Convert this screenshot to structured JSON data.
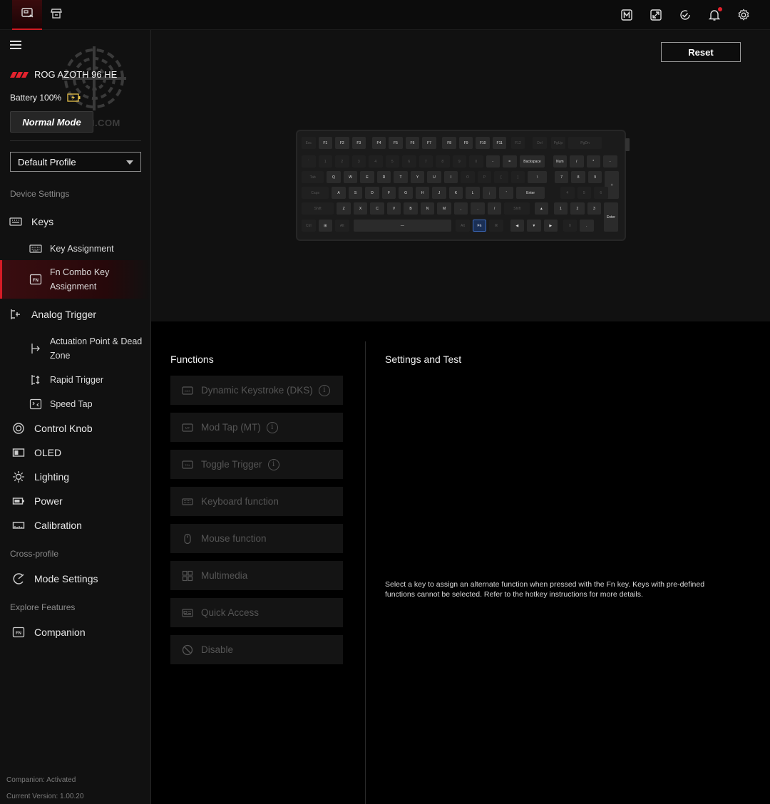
{
  "topbar": {
    "tabs": [
      {
        "icon": "device-icon",
        "active": true
      },
      {
        "icon": "store-icon",
        "active": false
      }
    ],
    "icons": [
      "macro-icon",
      "screen-capture-icon",
      "update-check-icon",
      "notification-bell-icon",
      "settings-gear-icon"
    ]
  },
  "sidebar": {
    "device_name": "ROG AZOTH 96 HE",
    "battery": "Battery 100%",
    "mode": "Normal Mode",
    "watermark": "ECH.COM",
    "profile": "Default Profile",
    "section_device": "Device Settings",
    "keys": "Keys",
    "key_assignment": "Key Assignment",
    "fn_combo_line1": "Fn Combo Key",
    "fn_combo_line2": "Assignment",
    "analog_trigger": "Analog Trigger",
    "actuation_line1": "Actuation Point & Dead",
    "actuation_line2": "Zone",
    "rapid_trigger": "Rapid Trigger",
    "speed_tap": "Speed Tap",
    "control_knob": "Control Knob",
    "oled": "OLED",
    "lighting": "Lighting",
    "power": "Power",
    "calibration": "Calibration",
    "section_cross": "Cross-profile",
    "mode_settings": "Mode Settings",
    "section_explore": "Explore Features",
    "companion": "Companion",
    "footer_companion": "Companion: Activated",
    "footer_version": "Current Version: 1.00.20"
  },
  "main": {
    "reset": "Reset",
    "keyboard": {
      "selected_key": "Fn",
      "rows": [
        [
          "Esc",
          "F1",
          "F2",
          "F3",
          "F4",
          "F5",
          "F6",
          "F7",
          "F8",
          "F9",
          "F10",
          "F11",
          "F12",
          "Del",
          "PgUp",
          "PgDn"
        ],
        [
          "`",
          "1",
          "2",
          "3",
          "4",
          "5",
          "6",
          "7",
          "8",
          "9",
          "0",
          "-",
          "=",
          "Backspace",
          "Num",
          "/",
          "*",
          "-"
        ],
        [
          "Tab",
          "Q",
          "W",
          "E",
          "R",
          "T",
          "Y",
          "U",
          "I",
          "O",
          "P",
          "[",
          "]",
          "\\",
          "7",
          "8",
          "9",
          "+"
        ],
        [
          "Caps",
          "A",
          "S",
          "D",
          "F",
          "G",
          "H",
          "J",
          "K",
          "L",
          ";",
          "'",
          "Enter",
          "4",
          "5",
          "6"
        ],
        [
          "Shift",
          "Z",
          "X",
          "C",
          "V",
          "B",
          "N",
          "M",
          ",",
          ".",
          "/",
          "Shift",
          "▲",
          "1",
          "2",
          "3",
          "Enter"
        ],
        [
          "Ctrl",
          "⊞",
          "Alt",
          "—",
          "Alt",
          "Fn",
          "⌘",
          "◀",
          "▼",
          "▶",
          "0",
          "."
        ]
      ]
    },
    "functions_title": "Functions",
    "settings_title": "Settings and Test",
    "functions": [
      {
        "label": "Dynamic Keystroke (DKS)",
        "icon": "dks-icon",
        "info": true
      },
      {
        "label": "Mod Tap (MT)",
        "icon": "mt-icon",
        "info": true
      },
      {
        "label": "Toggle Trigger",
        "icon": "toggle-trigger-icon",
        "info": true
      },
      {
        "label": "Keyboard function",
        "icon": "keyboard-icon",
        "info": false
      },
      {
        "label": "Mouse function",
        "icon": "mouse-icon",
        "info": false
      },
      {
        "label": "Multimedia",
        "icon": "multimedia-icon",
        "info": false
      },
      {
        "label": "Quick Access",
        "icon": "quick-access-icon",
        "info": false
      },
      {
        "label": "Disable",
        "icon": "disable-icon",
        "info": false
      }
    ],
    "info_glyph": "i",
    "hint": "Select a key to assign an alternate function when pressed with the Fn key. Keys with pre-defined functions cannot be selected. Refer to the hotkey instructions for more details."
  },
  "colors": {
    "accent": "#d61c26",
    "selected_key": "#3d6bc0"
  }
}
